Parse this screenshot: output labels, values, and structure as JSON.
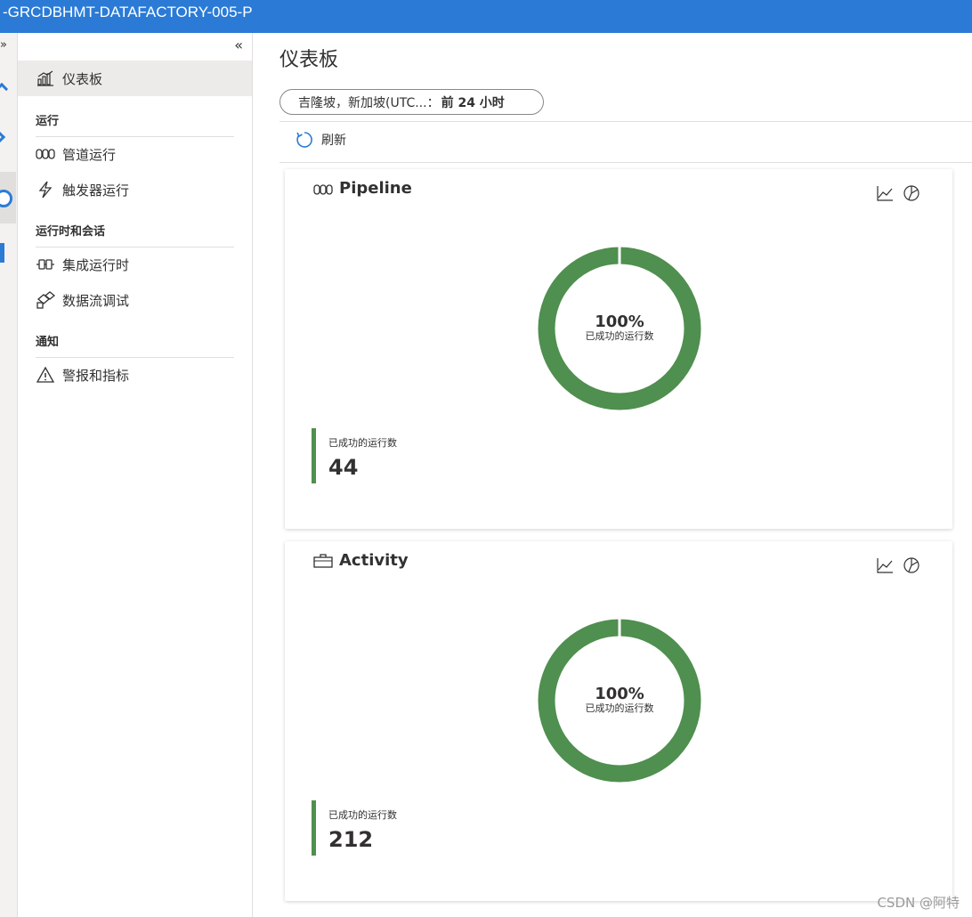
{
  "topbar": {
    "title": "-GRCDBHMT-DATAFACTORY-005-P"
  },
  "rail": {
    "expand_glyph": "»"
  },
  "sidenav": {
    "collapse_glyph": "«",
    "dashboard": {
      "label": "仪表板",
      "icon": "bar-chart-icon"
    },
    "sections": [
      {
        "title": "运行",
        "items": [
          {
            "label": "管道运行",
            "icon": "pipeline-icon"
          },
          {
            "label": "触发器运行",
            "icon": "lightning-icon"
          }
        ]
      },
      {
        "title": "运行时和会话",
        "items": [
          {
            "label": "集成运行时",
            "icon": "integration-runtime-icon"
          },
          {
            "label": "数据流调试",
            "icon": "dataflow-debug-icon"
          }
        ]
      },
      {
        "title": "通知",
        "items": [
          {
            "label": "警报和指标",
            "icon": "warning-icon"
          }
        ]
      }
    ]
  },
  "main": {
    "title": "仪表板",
    "filter": {
      "timezone": "吉隆坡，新加坡(UTC...",
      "separator": "：",
      "range": "前 24 小时"
    },
    "refresh_label": "刷新"
  },
  "cards": [
    {
      "title": "Pipeline",
      "icon": "pipeline-icon",
      "donut": {
        "percent_text": "100%",
        "label": "已成功的运行数",
        "success_fraction": 1.0,
        "color": "#4f8f4f"
      },
      "stat": {
        "label": "已成功的运行数",
        "value": "44"
      }
    },
    {
      "title": "Activity",
      "icon": "briefcase-icon",
      "donut": {
        "percent_text": "100%",
        "label": "已成功的运行数",
        "success_fraction": 1.0,
        "color": "#4f8f4f"
      },
      "stat": {
        "label": "已成功的运行数",
        "value": "212"
      }
    }
  ],
  "watermark": "CSDN @阿特"
}
